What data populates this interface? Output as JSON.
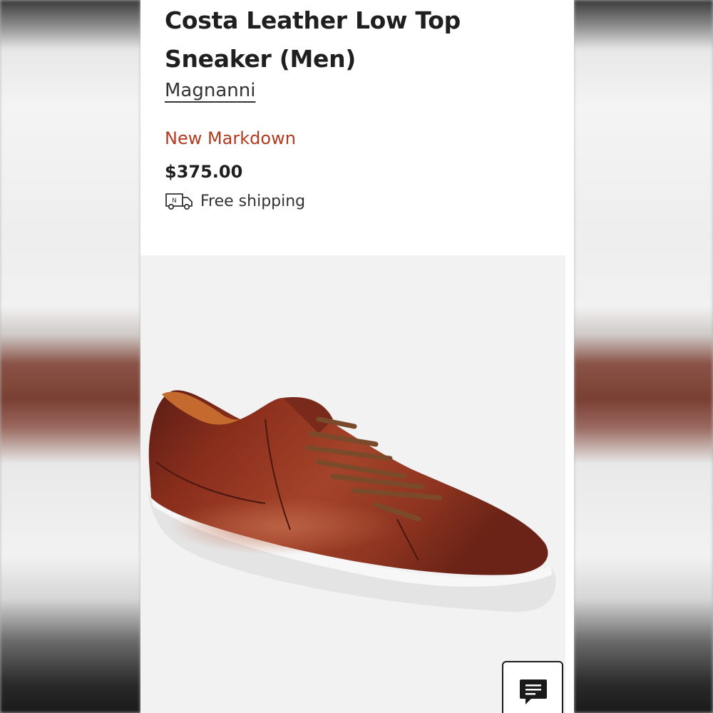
{
  "product": {
    "title": "Costa Leather Low Top Sneaker (Men)",
    "brand": "Magnanni",
    "badge": "New Markdown",
    "price": "$375.00",
    "shipping": {
      "icon": "delivery-truck-icon",
      "icon_letter": "N",
      "label": "Free shipping"
    },
    "image": {
      "subject": "brown-leather-sneaker"
    }
  },
  "chat": {
    "icon": "chat-bubble-icon"
  },
  "colors": {
    "markdown": "#b23a1e",
    "text": "#1f1f1f",
    "image_background": "#f2f2f2"
  }
}
